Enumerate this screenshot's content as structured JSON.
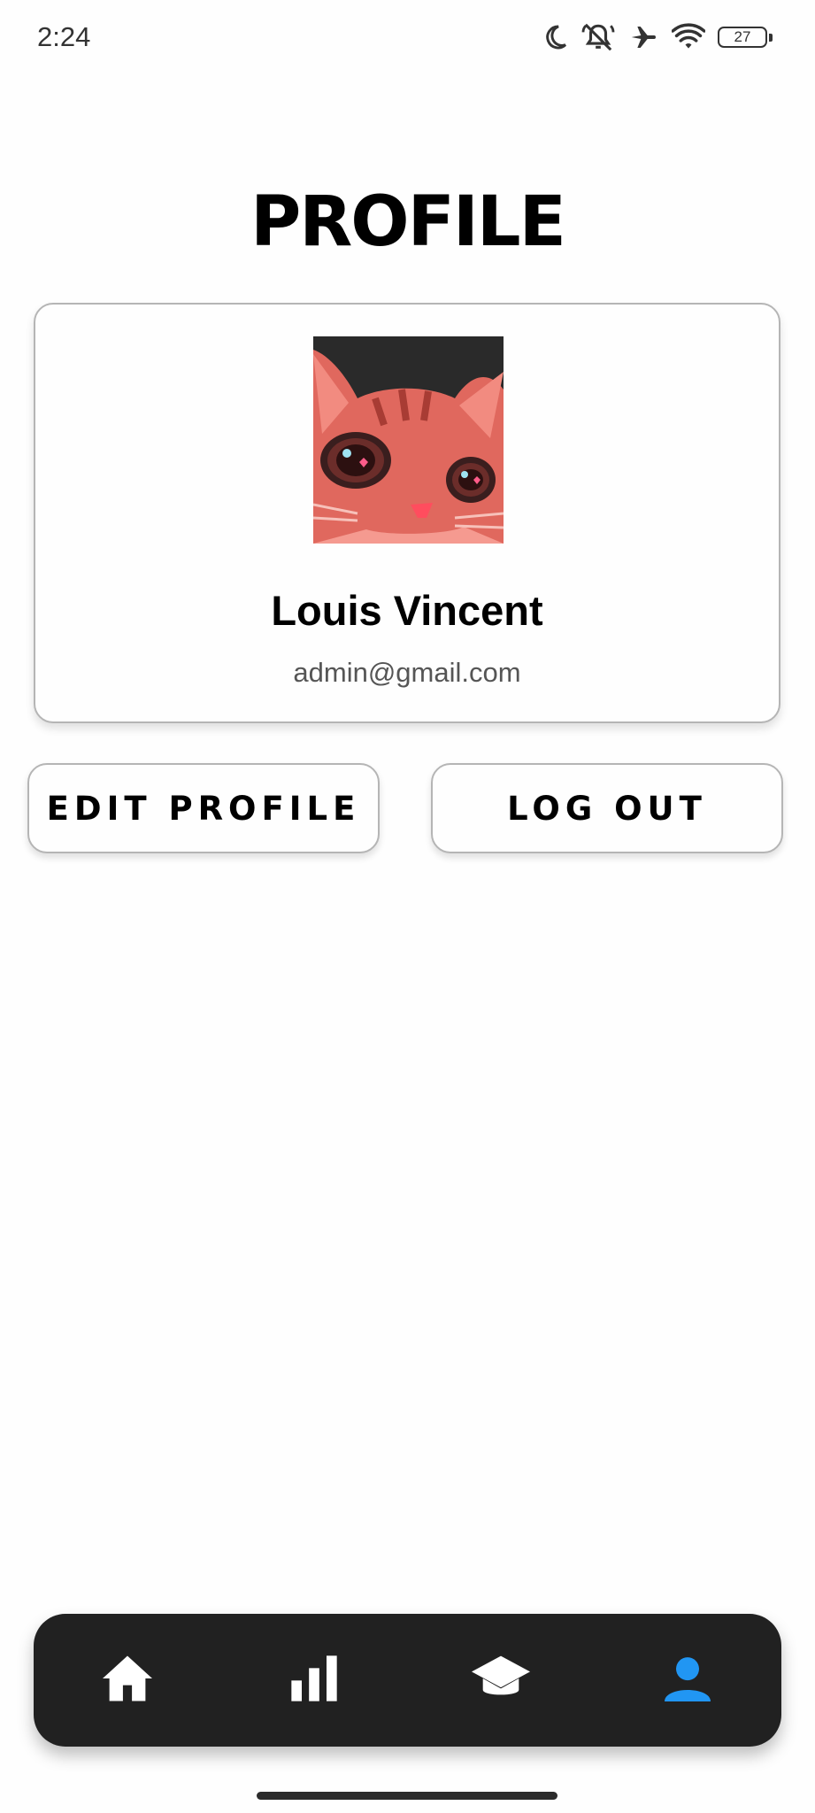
{
  "status_bar": {
    "time": "2:24",
    "battery": "27",
    "icons": [
      "moon-icon",
      "bell-off-icon",
      "airplane-icon",
      "wifi-icon",
      "battery-icon"
    ]
  },
  "page": {
    "title": "PROFILE"
  },
  "profile": {
    "name": "Louis Vincent",
    "email": "admin@gmail.com",
    "avatar_icon": "cat-avatar"
  },
  "actions": {
    "edit_label": "EDIT PROFILE",
    "logout_label": "LOG OUT"
  },
  "bottom_nav": {
    "items": [
      {
        "icon": "home-icon",
        "active": false
      },
      {
        "icon": "bar-chart-icon",
        "active": false
      },
      {
        "icon": "graduation-cap-icon",
        "active": false
      },
      {
        "icon": "person-icon",
        "active": true
      }
    ],
    "active_color": "#2196f3",
    "inactive_color": "#ffffff",
    "background": "#212121"
  }
}
